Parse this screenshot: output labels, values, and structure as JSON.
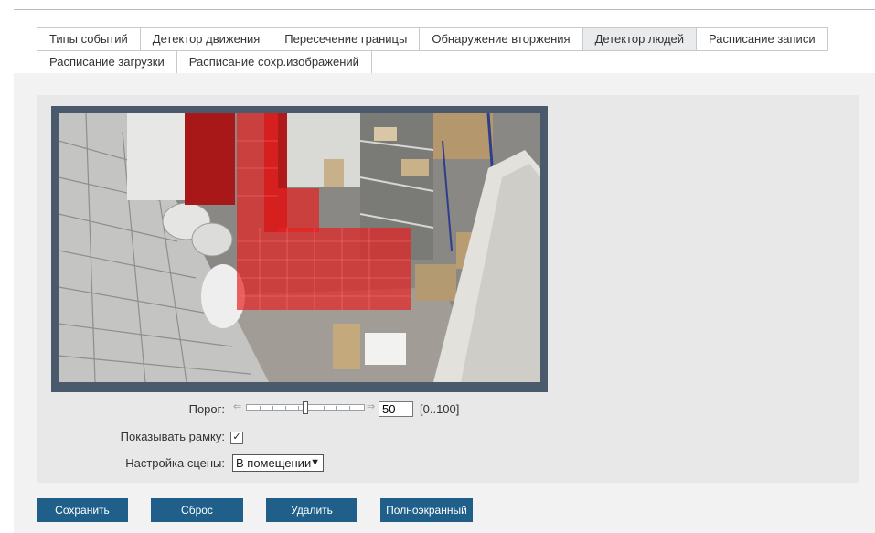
{
  "tabs": {
    "row1": [
      {
        "label": "Типы событий",
        "active": false
      },
      {
        "label": "Детектор движения",
        "active": false
      },
      {
        "label": "Пересечение границы",
        "active": false
      },
      {
        "label": "Обнаружение вторжения",
        "active": false
      },
      {
        "label": "Детектор людей",
        "active": true
      },
      {
        "label": "Расписание записи",
        "active": false
      }
    ],
    "row2": [
      {
        "label": "Расписание загрузки",
        "active": false
      },
      {
        "label": "Расписание сохр.изображений",
        "active": false
      }
    ]
  },
  "settings": {
    "threshold_label": "Порог:",
    "threshold_value": "50",
    "threshold_fraction": 0.5,
    "threshold_range": "[0..100]",
    "show_frame_label": "Показывать рамку:",
    "show_frame_checked": true,
    "scene_label": "Настройка сцены:",
    "scene_value": "В помещении"
  },
  "buttons": {
    "save": "Сохранить",
    "reset": "Сброс",
    "delete": "Удалить",
    "fullscreen": "Полноэкранный"
  },
  "colors": {
    "accent": "#1f5f8a",
    "detection_zone": "#e52222",
    "video_frame": "#4a5a6c"
  }
}
